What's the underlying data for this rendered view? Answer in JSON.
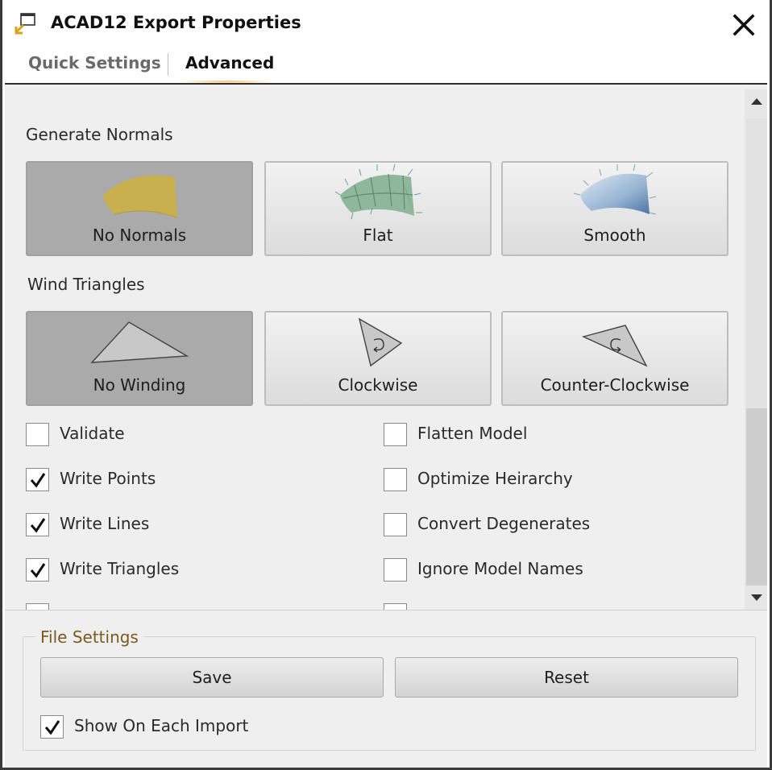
{
  "window": {
    "title": "ACAD12 Export Properties",
    "icon": "export-icon",
    "close_icon": "close-icon"
  },
  "tabs": [
    {
      "label": "Quick Settings",
      "active": false
    },
    {
      "label": "Advanced",
      "active": true
    }
  ],
  "generate_normals": {
    "label": "Generate Normals",
    "options": [
      {
        "label": "No Normals",
        "icon": "no-normals-surface-icon",
        "selected": true
      },
      {
        "label": "Flat",
        "icon": "flat-normals-surface-icon",
        "selected": false
      },
      {
        "label": "Smooth",
        "icon": "smooth-normals-surface-icon",
        "selected": false
      }
    ]
  },
  "wind_triangles": {
    "label": "Wind Triangles",
    "options": [
      {
        "label": "No Winding",
        "icon": "triangle-icon",
        "selected": true
      },
      {
        "label": "Clockwise",
        "icon": "clockwise-triangle-icon",
        "selected": false
      },
      {
        "label": "Counter-Clockwise",
        "icon": "counter-clockwise-triangle-icon",
        "selected": false
      }
    ]
  },
  "checkboxes_left": [
    {
      "label": "Validate",
      "checked": false
    },
    {
      "label": "Write Points",
      "checked": true
    },
    {
      "label": "Write Lines",
      "checked": true
    },
    {
      "label": "Write Triangles",
      "checked": true
    }
  ],
  "checkboxes_right": [
    {
      "label": "Flatten Model",
      "checked": false
    },
    {
      "label": "Optimize Heirarchy",
      "checked": false
    },
    {
      "label": "Convert Degenerates",
      "checked": false
    },
    {
      "label": "Ignore Model Names",
      "checked": false
    }
  ],
  "file_settings": {
    "title": "File Settings",
    "save_label": "Save",
    "reset_label": "Reset",
    "show_on_import": {
      "label": "Show On Each Import",
      "checked": true
    }
  },
  "colors": {
    "selected_button": "#aaaaaa",
    "group_title": "#7b5a1e",
    "tab_accent": "#ffb95a"
  }
}
